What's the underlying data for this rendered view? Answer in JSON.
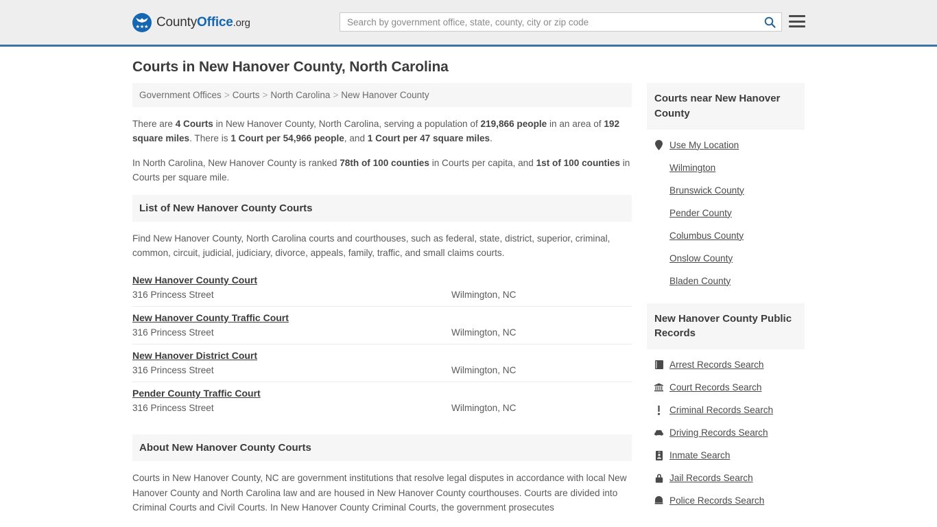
{
  "header": {
    "logo": {
      "part1": "County",
      "part2": "Office",
      "part3": ".org",
      "icon": "eagle-logo-icon"
    },
    "search": {
      "placeholder": "Search by government office, state, county, city or zip code",
      "value": "",
      "icon": "search-icon"
    },
    "menu_icon": "hamburger-menu-icon",
    "accent_color": "#1667b1",
    "border_color": "#3d72a4",
    "background": "#eeeeee"
  },
  "page": {
    "title": "Courts in New Hanover County, North Carolina"
  },
  "breadcrumb": {
    "items": [
      {
        "label": "Government Offices"
      },
      {
        "label": "Courts"
      },
      {
        "label": "North Carolina"
      },
      {
        "label": "New Hanover County"
      }
    ],
    "separator": ">"
  },
  "intro": {
    "paragraph1": {
      "t1": "There are ",
      "b1": "4 Courts",
      "t2": " in New Hanover County, North Carolina, serving a population of ",
      "b2": "219,866 people",
      "t3": " in an area of ",
      "b3": "192 square miles",
      "t4": ". There is ",
      "b4": "1 Court per 54,966 people",
      "t5": ", and ",
      "b5": "1 Court per 47 square miles",
      "t6": "."
    },
    "paragraph2": {
      "t1": "In North Carolina, New Hanover County is ranked ",
      "b1": "78th of 100 counties",
      "t2": " in Courts per capita, and ",
      "b2": "1st of 100 counties",
      "t3": " in Courts per square mile."
    }
  },
  "list_section": {
    "heading": "List of New Hanover County Courts",
    "description": "Find New Hanover County, North Carolina courts and courthouses, such as federal, state, district, superior, criminal, common, circuit, judicial, judiciary, divorce, appeals, family, traffic, and small claims courts.",
    "courts": [
      {
        "name": "New Hanover County Court",
        "address": "316 Princess Street",
        "city": "Wilmington, NC"
      },
      {
        "name": "New Hanover County Traffic Court",
        "address": "316 Princess Street",
        "city": "Wilmington, NC"
      },
      {
        "name": "New Hanover District Court",
        "address": "316 Princess Street",
        "city": "Wilmington, NC"
      },
      {
        "name": "Pender County Traffic Court",
        "address": "316 Princess Street",
        "city": "Wilmington, NC"
      }
    ]
  },
  "about_section": {
    "heading": "About New Hanover County Courts",
    "paragraph": "Courts in New Hanover County, NC are government institutions that resolve legal disputes in accordance with local New Hanover County and North Carolina law and are housed in New Hanover County courthouses. Courts are divided into Criminal Courts and Civil Courts. In New Hanover County Criminal Courts, the government prosecutes"
  },
  "sidebar": {
    "nearby": {
      "heading": "Courts near New Hanover County",
      "items": [
        {
          "label": "Use My Location",
          "icon": "map-pin-icon"
        },
        {
          "label": "Wilmington",
          "icon": ""
        },
        {
          "label": "Brunswick County",
          "icon": ""
        },
        {
          "label": "Pender County",
          "icon": ""
        },
        {
          "label": "Columbus County",
          "icon": ""
        },
        {
          "label": "Onslow County",
          "icon": ""
        },
        {
          "label": "Bladen County",
          "icon": ""
        }
      ]
    },
    "public_records": {
      "heading": "New Hanover County Public Records",
      "items": [
        {
          "label": "Arrest Records Search",
          "icon": "book-icon"
        },
        {
          "label": "Court Records Search",
          "icon": "courthouse-icon"
        },
        {
          "label": "Criminal Records Search",
          "icon": "exclamation-icon"
        },
        {
          "label": "Driving Records Search",
          "icon": "car-icon"
        },
        {
          "label": "Inmate Search",
          "icon": "id-card-icon"
        },
        {
          "label": "Jail Records Search",
          "icon": "lock-icon"
        },
        {
          "label": "Police Records Search",
          "icon": "police-badge-icon"
        }
      ]
    }
  }
}
